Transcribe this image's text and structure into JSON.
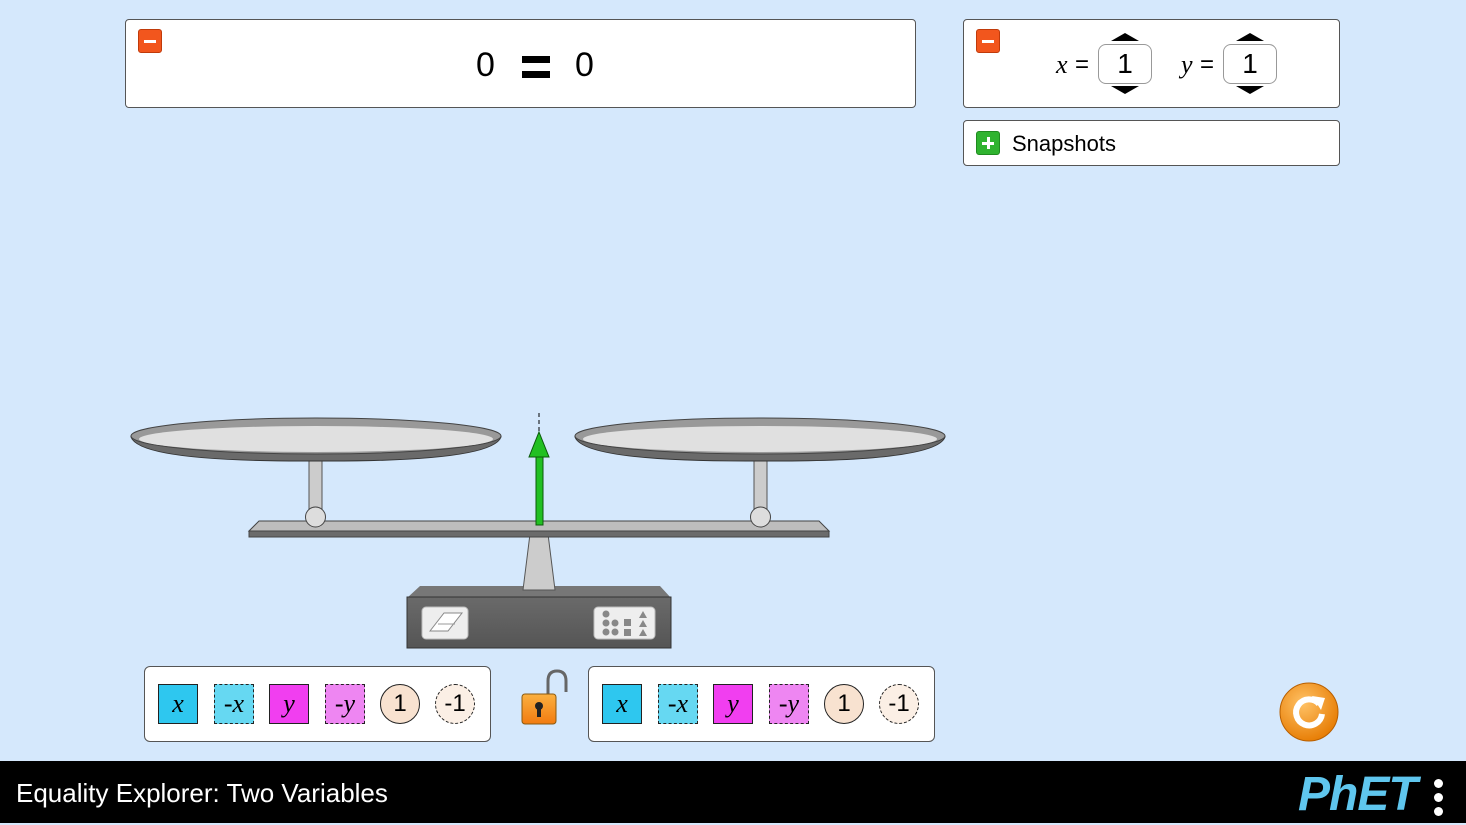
{
  "equation": {
    "left": "0",
    "right": "0"
  },
  "variables": [
    {
      "name": "x",
      "value": "1"
    },
    {
      "name": "y",
      "value": "1"
    }
  ],
  "snapshots": {
    "label": "Snapshots"
  },
  "left_toolbox": {
    "items": [
      "x",
      "-x",
      "y",
      "-y",
      "1",
      "-1"
    ]
  },
  "right_toolbox": {
    "items": [
      "x",
      "-x",
      "y",
      "-y",
      "1",
      "-1"
    ]
  },
  "footer": {
    "title": "Equality Explorer: Two Variables",
    "brand": "PhET"
  },
  "colors": {
    "background": "#d5e8fc",
    "x_tile": "#2ec7ef",
    "y_tile": "#f13ef0",
    "collapse_button": "#f2561d",
    "expand_button": "#2fb32f",
    "balance_arrow": "#22c022",
    "reset_button": "#f7941d"
  },
  "icons": [
    "collapse-icon",
    "expand-icon",
    "eraser-icon",
    "organize-icon",
    "lock-open-icon",
    "reset-all-icon",
    "options-menu-icon"
  ]
}
